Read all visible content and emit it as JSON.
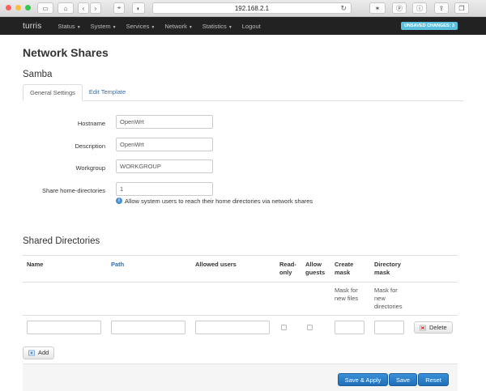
{
  "browser": {
    "url": "192.168.2.1"
  },
  "nav": {
    "brand": "turris",
    "items": [
      "Status",
      "System",
      "Services",
      "Network",
      "Statistics"
    ],
    "logout": "Logout",
    "unsaved": "UNSAVED CHANGES: 3"
  },
  "page": {
    "title": "Network Shares",
    "section": "Samba",
    "tabs": [
      "General Settings",
      "Edit Template"
    ]
  },
  "form": {
    "hostname_label": "Hostname",
    "hostname_value": "OpenWrt",
    "description_label": "Description",
    "description_value": "OpenWrt",
    "workgroup_label": "Workgroup",
    "workgroup_value": "WORKGROUP",
    "homedirs_label": "Share home-directories",
    "homedirs_value": "1",
    "homedirs_help": "Allow system users to reach their home directories via network shares"
  },
  "shares": {
    "title": "Shared Directories",
    "columns": {
      "name": "Name",
      "path": "Path",
      "users": "Allowed users",
      "readonly_1": "Read-",
      "readonly_2": "only",
      "guests_1": "Allow",
      "guests_2": "guests",
      "create_1": "Create",
      "create_2": "mask",
      "dir_1": "Directory",
      "dir_2": "mask"
    },
    "create_desc": [
      "Mask for",
      "new files"
    ],
    "dir_desc": [
      "Mask for",
      "new",
      "directories"
    ],
    "delete_label": "Delete",
    "add_label": "Add"
  },
  "footer": {
    "save_apply": "Save & Apply",
    "save": "Save",
    "reset": "Reset"
  }
}
